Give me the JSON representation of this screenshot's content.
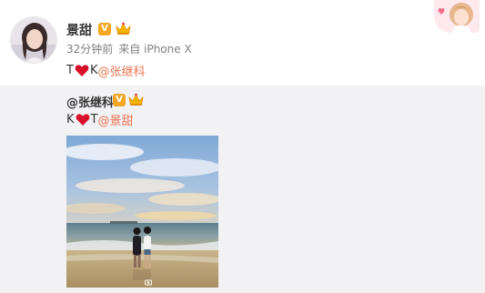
{
  "post": {
    "author": "景甜",
    "time_ago": "32分钟前",
    "source_prefix": "来自",
    "source_device": "iPhone X",
    "text_before": "T",
    "text_after": "K",
    "mention": "@张继科"
  },
  "repost": {
    "author": "@张继科",
    "text_before": "K",
    "text_after": "T",
    "mention": "@景甜"
  },
  "badges": {
    "verified_letter": "V"
  },
  "icons": {
    "verified": "verified-badge-icon",
    "vip": "crown-icon",
    "heart": "heart-icon",
    "camera": "camera-icon"
  },
  "colors": {
    "mention": "#eb7350",
    "verified": "#f5a623",
    "repost_bg": "#f2f2f5",
    "heart": "#d8102a"
  }
}
